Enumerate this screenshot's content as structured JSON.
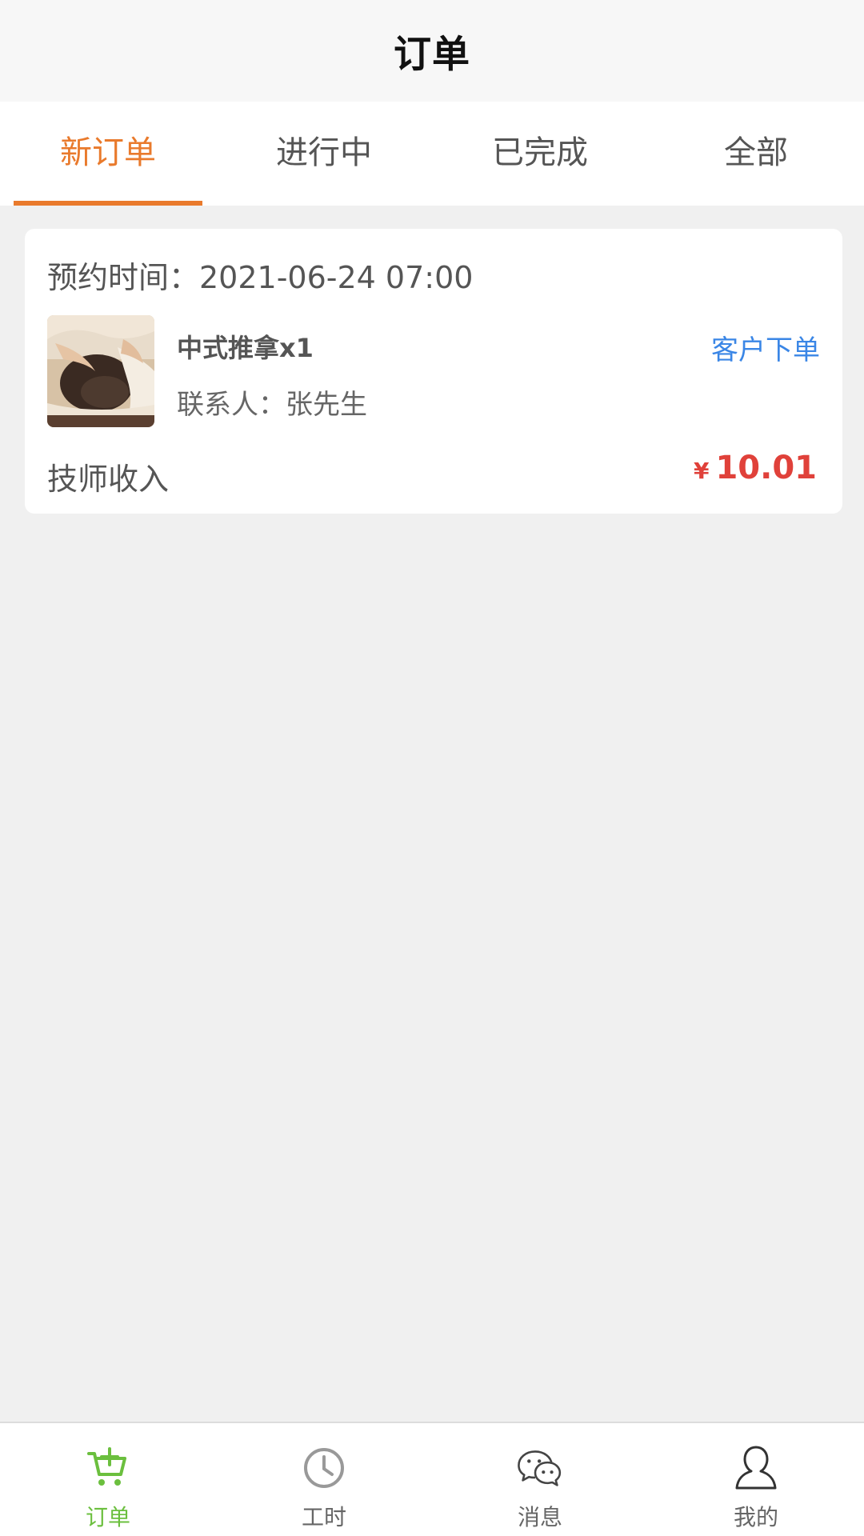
{
  "header": {
    "title": "订单"
  },
  "tabs": [
    {
      "label": "新订单",
      "active": true
    },
    {
      "label": "进行中",
      "active": false
    },
    {
      "label": "已完成",
      "active": false
    },
    {
      "label": "全部",
      "active": false
    }
  ],
  "order": {
    "appointment": "预约时间：2021-06-24 07:00",
    "service": "中式推拿x1",
    "source": "客户下单",
    "contact": "联系人：张先生",
    "income_label": "技师收入",
    "currency": "¥",
    "amount": "10.01"
  },
  "bottom_nav": [
    {
      "label": "订单",
      "icon": "cart-icon",
      "active": true
    },
    {
      "label": "工时",
      "icon": "clock-icon",
      "active": false
    },
    {
      "label": "消息",
      "icon": "chat-icon",
      "active": false
    },
    {
      "label": "我的",
      "icon": "user-icon",
      "active": false
    }
  ],
  "colors": {
    "accent": "#e97a2c",
    "link": "#3a86e6",
    "price": "#e0413a",
    "nav_active": "#6bbf3e"
  }
}
